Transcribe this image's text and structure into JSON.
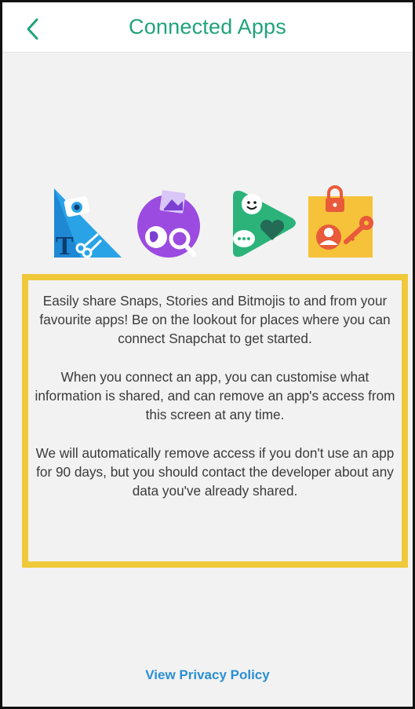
{
  "header": {
    "title": "Connected Apps",
    "back_icon": "chevron-left-icon"
  },
  "illustrations": [
    {
      "name": "creative-tools-icon",
      "desc_colors": [
        "#2aa3e6",
        "#1565c0"
      ]
    },
    {
      "name": "discover-world-icon",
      "desc_colors": [
        "#9b4be0",
        "#f3c238"
      ]
    },
    {
      "name": "chat-stickers-icon",
      "desc_colors": [
        "#2bb37a",
        "#236b54"
      ]
    },
    {
      "name": "secure-profile-icon",
      "desc_colors": [
        "#f5c23a",
        "#e85a3a"
      ]
    }
  ],
  "info": {
    "paragraph_1": "Easily share Snaps, Stories and Bitmojis to and from your favourite apps! Be on the lookout for places where you can connect Snapchat to get started.",
    "paragraph_2": "When you connect an app, you can customise what information is shared, and can remove an app's access from this screen at any time.",
    "paragraph_3": "We will automatically remove access if you don't use an app for 90 days, but you should contact the developer about any data you've already shared."
  },
  "footer": {
    "privacy_label": "View Privacy Policy"
  },
  "colors": {
    "accent": "#1fa37a",
    "link": "#2a8fd3",
    "highlight_border": "#f0c93a"
  }
}
